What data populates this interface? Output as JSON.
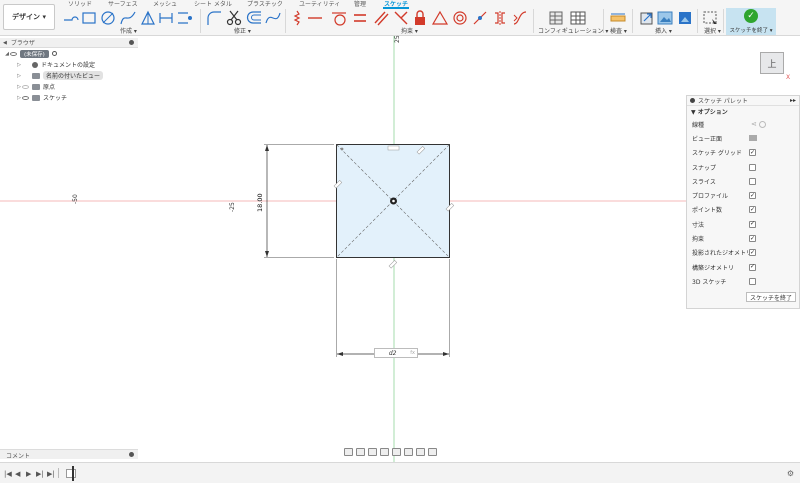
{
  "workspace": {
    "label": "デザイン ▾"
  },
  "tabs": [
    {
      "label": "ソリッド",
      "active": false
    },
    {
      "label": "サーフェス",
      "active": false
    },
    {
      "label": "メッシュ",
      "active": false
    },
    {
      "label": "シート メタル",
      "active": false
    },
    {
      "label": "プラスチック",
      "active": false
    },
    {
      "label": "ユーティリティ",
      "active": false
    },
    {
      "label": "管理",
      "active": false
    },
    {
      "label": "スケッチ",
      "active": true
    }
  ],
  "groups": {
    "create": "作成 ▾",
    "modify": "修正 ▾",
    "constraint": "拘束 ▾",
    "configure": "コンフィギュレーション ▾",
    "inspect": "検査 ▾",
    "insert": "挿入 ▾",
    "select": "選択 ▾",
    "finish": "スケッチを終了 ▾"
  },
  "browser": {
    "title": "ブラウザ",
    "root": "(未保存)",
    "items": [
      {
        "label": "ドキュメントの設定",
        "icon": "gear-icon"
      },
      {
        "label": "名前の付いたビュー",
        "icon": "folder-icon"
      },
      {
        "label": "原点",
        "icon": "folder-icon"
      },
      {
        "label": "スケッチ",
        "icon": "folder-icon"
      }
    ]
  },
  "comments": {
    "title": "コメント"
  },
  "palette": {
    "title": "スケッチ パレット",
    "section": "▼ オプション",
    "options": [
      {
        "label": "線種",
        "type": "linetype"
      },
      {
        "label": "ビュー正面",
        "type": "look-at"
      },
      {
        "label": "スケッチ グリッド",
        "checked": true
      },
      {
        "label": "スナップ",
        "checked": false
      },
      {
        "label": "スライス",
        "checked": false
      },
      {
        "label": "プロファイル",
        "checked": true
      },
      {
        "label": "ポイント数",
        "checked": true
      },
      {
        "label": "寸法",
        "checked": true
      },
      {
        "label": "拘束",
        "checked": true
      },
      {
        "label": "投影されたジオメトリ",
        "checked": true
      },
      {
        "label": "構築ジオメトリ",
        "checked": true
      },
      {
        "label": "3D スケッチ",
        "checked": false
      }
    ],
    "finish_button": "スケッチを終了"
  },
  "viewcube": {
    "face": "上",
    "axis": "X"
  },
  "canvas": {
    "axis_labels": {
      "x_neg50": "-50",
      "x_neg25": "-25",
      "y_25": "25"
    },
    "dimension_vertical": "18.00",
    "dimension_input": {
      "value": "d2",
      "fx": "fx"
    }
  },
  "colors": {
    "accent": "#0696d7",
    "profile_fill": "#e3f1fb",
    "x_axis": "#f2a0a0",
    "y_axis": "#8fd39a",
    "finish_green": "#2fa52f"
  }
}
